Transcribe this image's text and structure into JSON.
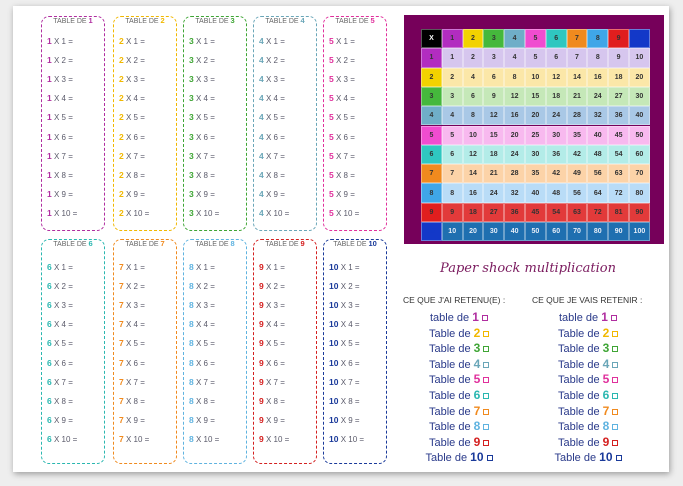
{
  "sheet_title": "Paper shock multiplication",
  "tables_top": [
    {
      "title": "TABLE DE",
      "n": "1",
      "color": "#b02ea0",
      "rows": [
        "1 X 1 =",
        "1 X 2 =",
        "1 X 3 =",
        "1 X 4 =",
        "1 X 5 =",
        "1 X 6 =",
        "1 X 7 =",
        "1 X 8 =",
        "1 X 9 =",
        "1 X 10 ="
      ]
    },
    {
      "title": "TABLE DE",
      "n": "2",
      "color": "#f1b800",
      "rows": [
        "2 X 1 =",
        "2 X 2 =",
        "2 X 3 =",
        "2 X 4 =",
        "2 X 5 =",
        "2 X 6 =",
        "2 X 7 =",
        "2 X 8 =",
        "2 X 9 =",
        "2 X 10 ="
      ]
    },
    {
      "title": "TABLE DE",
      "n": "3",
      "color": "#3fa535",
      "rows": [
        "3 X 1 =",
        "3 X 2 =",
        "3 X 3 =",
        "3 X 4 =",
        "3 X 5 =",
        "3 X 6 =",
        "3 X 7 =",
        "3 X 8 =",
        "3 X 9 =",
        "3 X 10 ="
      ]
    },
    {
      "title": "TABLE DE",
      "n": "4",
      "color": "#6aa6b8",
      "rows": [
        "4 X 1 =",
        "4 X 2 =",
        "4 X 3 =",
        "4 X 4 =",
        "4 X 5 =",
        "4 X 6 =",
        "4 X 7 =",
        "4 X 8 =",
        "4 X 9 =",
        "4 X 10 ="
      ]
    },
    {
      "title": "TABLE DE",
      "n": "5",
      "color": "#e0309c",
      "rows": [
        "5 X 1 =",
        "5 X 2 =",
        "5 X 3 =",
        "5 X 4 =",
        "5 X 5 =",
        "5 X 6 =",
        "5 X 7 =",
        "5 X 8 =",
        "5 X 9 =",
        "5 X 10 ="
      ]
    }
  ],
  "tables_bottom": [
    {
      "title": "TABLE DE",
      "n": "6",
      "color": "#2ab7b0",
      "rows": [
        "6 X 1 =",
        "6 X 2 =",
        "6 X 3 =",
        "6 X 4 =",
        "6 X 5 =",
        "6 X 6 =",
        "6 X 7 =",
        "6 X 8 =",
        "6 X 9 =",
        "6 X 10 ="
      ]
    },
    {
      "title": "TABLE DE",
      "n": "7",
      "color": "#f08a1e",
      "rows": [
        "7 X 1 =",
        "7 X 2 =",
        "7 X 3 =",
        "7 X 4 =",
        "7 X 5 =",
        "7 X 6 =",
        "7 X 7 =",
        "7 X 8 =",
        "7 X 9 =",
        "7 X 10 ="
      ]
    },
    {
      "title": "TABLE DE",
      "n": "8",
      "color": "#5fb3e0",
      "rows": [
        "8 X 1 =",
        "8 X 2 =",
        "8 X 3 =",
        "8 X 4 =",
        "8 X 5 =",
        "8 X 6 =",
        "8 X 7 =",
        "8 X 8 =",
        "8 X 9 =",
        "8 X 10 ="
      ]
    },
    {
      "title": "TABLE DE",
      "n": "9",
      "color": "#d42020",
      "rows": [
        "9 X 1 =",
        "9 X 2 =",
        "9 X 3 =",
        "9 X 4 =",
        "9 X 5 =",
        "9 X 6 =",
        "9 X 7 =",
        "9 X 8 =",
        "9 X 9 =",
        "9 X 10 ="
      ]
    },
    {
      "title": "TABLE DE",
      "n": "10",
      "color": "#1a3a9a",
      "rows": [
        "10 X 1 =",
        "10 X 2 =",
        "10 X 3 =",
        "10 X 4 =",
        "10 X 5 =",
        "10 X 6 =",
        "10 X 7 =",
        "10 X 8 =",
        "10 X 9 =",
        "10 X 10 ="
      ]
    }
  ],
  "grid": {
    "corner": "X",
    "header_colors": [
      "#b22cc0",
      "#f2d200",
      "#45b83c",
      "#6faec8",
      "#f04cd0",
      "#2fc7c0",
      "#f08a1e",
      "#3fa6e8",
      "#e01e1e",
      "#1338c8"
    ],
    "row_colors": [
      "#d6c6ee",
      "#fbe7a8",
      "#c5e8b8",
      "#a9c8e6",
      "#f8b9ef",
      "#b3ece8",
      "#fcd3a8",
      "#b9dcf7",
      "#e23a3a",
      "#1f6fb0"
    ],
    "values": [
      [
        1,
        2,
        3,
        4,
        5,
        6,
        7,
        8,
        9,
        10
      ],
      [
        2,
        4,
        6,
        8,
        10,
        12,
        14,
        16,
        18,
        20
      ],
      [
        3,
        6,
        9,
        12,
        15,
        18,
        21,
        24,
        27,
        30
      ],
      [
        4,
        8,
        12,
        16,
        20,
        24,
        28,
        32,
        36,
        40
      ],
      [
        5,
        10,
        15,
        20,
        25,
        30,
        35,
        40,
        45,
        50
      ],
      [
        6,
        12,
        18,
        24,
        30,
        36,
        42,
        48,
        54,
        60
      ],
      [
        7,
        14,
        21,
        28,
        35,
        42,
        49,
        56,
        63,
        70
      ],
      [
        8,
        16,
        24,
        32,
        40,
        48,
        56,
        64,
        72,
        80
      ],
      [
        9,
        18,
        27,
        36,
        45,
        54,
        63,
        72,
        81,
        90
      ],
      [
        10,
        20,
        30,
        40,
        50,
        60,
        70,
        80,
        90,
        100
      ]
    ]
  },
  "retained": {
    "heading": "CE QUE J'AI RETENU(E) :",
    "items": [
      {
        "label": "table de",
        "n": "1"
      },
      {
        "label": "Table de",
        "n": "2"
      },
      {
        "label": "Table de",
        "n": "3"
      },
      {
        "label": "Table de",
        "n": "4"
      },
      {
        "label": "Table de",
        "n": "5"
      },
      {
        "label": "Table de",
        "n": "6"
      },
      {
        "label": "Table de",
        "n": "7"
      },
      {
        "label": "Table de",
        "n": "8"
      },
      {
        "label": "Table de",
        "n": "9"
      },
      {
        "label": "Table de",
        "n": "10"
      }
    ]
  },
  "to_retain": {
    "heading": "CE QUE JE VAIS RETENIR :",
    "items": [
      {
        "label": "table de",
        "n": "1"
      },
      {
        "label": "Table de",
        "n": "2"
      },
      {
        "label": "Table de",
        "n": "3"
      },
      {
        "label": "Table de",
        "n": "4"
      },
      {
        "label": "Table de",
        "n": "5"
      },
      {
        "label": "Table de",
        "n": "6"
      },
      {
        "label": "Table de",
        "n": "7"
      },
      {
        "label": "Table de",
        "n": "8"
      },
      {
        "label": "Table de",
        "n": "9"
      },
      {
        "label": "Table de",
        "n": "10"
      }
    ]
  }
}
